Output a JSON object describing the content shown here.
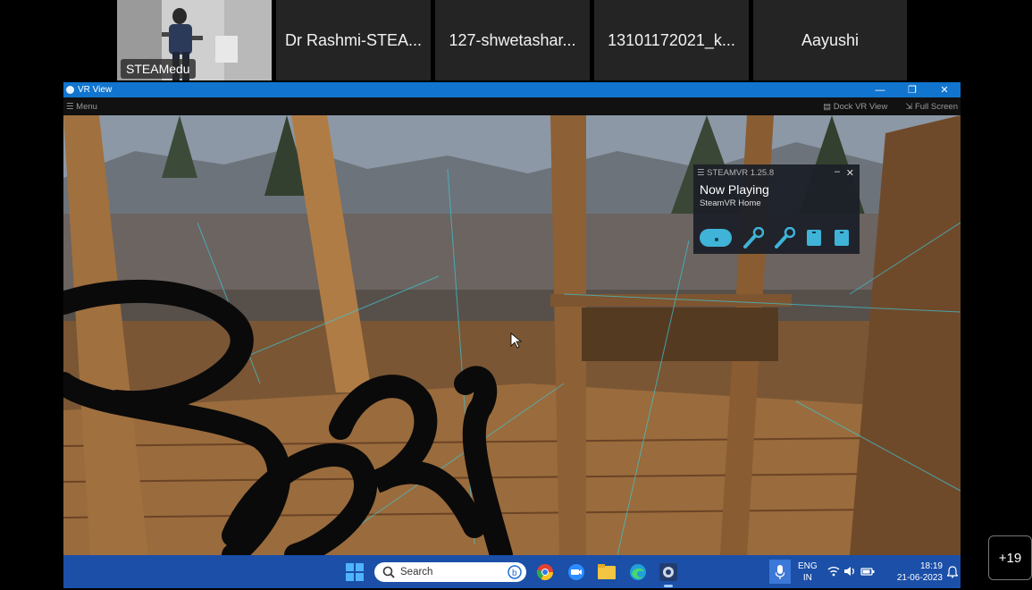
{
  "participants": [
    {
      "name": "STEAMedu",
      "has_video": true
    },
    {
      "name": "Dr Rashmi-STEA..."
    },
    {
      "name": "127-shwetashar..."
    },
    {
      "name": "13101172021_k..."
    },
    {
      "name": "Aayushi"
    }
  ],
  "vr_window": {
    "title": "VR View",
    "menu_label": "Menu",
    "dock_label": "Dock VR View",
    "fullscreen_label": "Full Screen",
    "controls": [
      "minimize",
      "restore",
      "close"
    ]
  },
  "steamvr_overlay": {
    "title": "STEAMVR 1.25.8",
    "now_playing_label": "Now Playing",
    "app_name": "SteamVR Home",
    "devices": [
      "headset-icon",
      "controller-left-icon",
      "controller-right-icon",
      "base-station-1-icon",
      "base-station-2-icon"
    ]
  },
  "taskbar": {
    "search_placeholder": "Search",
    "apps": [
      "windows-start-icon",
      "chrome-icon",
      "zoom-icon",
      "file-explorer-icon",
      "edge-icon",
      "steamvr-icon"
    ],
    "language_line1": "ENG",
    "language_line2": "IN",
    "time": "18:19",
    "date": "21-06-2023"
  },
  "more_participants": "+19",
  "colors": {
    "titlebar": "#1175cf",
    "taskbar": "#1b4fa8",
    "tile_bg": "#242424",
    "overlay_bg": "#1c2028",
    "device_teal": "#3fb3d8"
  }
}
